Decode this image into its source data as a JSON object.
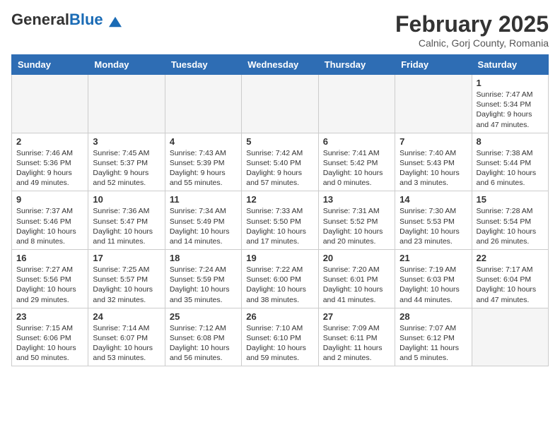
{
  "logo": {
    "general": "General",
    "blue": "Blue"
  },
  "header": {
    "month": "February 2025",
    "location": "Calnic, Gorj County, Romania"
  },
  "weekdays": [
    "Sunday",
    "Monday",
    "Tuesday",
    "Wednesday",
    "Thursday",
    "Friday",
    "Saturday"
  ],
  "weeks": [
    [
      {
        "day": "",
        "detail": ""
      },
      {
        "day": "",
        "detail": ""
      },
      {
        "day": "",
        "detail": ""
      },
      {
        "day": "",
        "detail": ""
      },
      {
        "day": "",
        "detail": ""
      },
      {
        "day": "",
        "detail": ""
      },
      {
        "day": "1",
        "detail": "Sunrise: 7:47 AM\nSunset: 5:34 PM\nDaylight: 9 hours and 47 minutes."
      }
    ],
    [
      {
        "day": "2",
        "detail": "Sunrise: 7:46 AM\nSunset: 5:36 PM\nDaylight: 9 hours and 49 minutes."
      },
      {
        "day": "3",
        "detail": "Sunrise: 7:45 AM\nSunset: 5:37 PM\nDaylight: 9 hours and 52 minutes."
      },
      {
        "day": "4",
        "detail": "Sunrise: 7:43 AM\nSunset: 5:39 PM\nDaylight: 9 hours and 55 minutes."
      },
      {
        "day": "5",
        "detail": "Sunrise: 7:42 AM\nSunset: 5:40 PM\nDaylight: 9 hours and 57 minutes."
      },
      {
        "day": "6",
        "detail": "Sunrise: 7:41 AM\nSunset: 5:42 PM\nDaylight: 10 hours and 0 minutes."
      },
      {
        "day": "7",
        "detail": "Sunrise: 7:40 AM\nSunset: 5:43 PM\nDaylight: 10 hours and 3 minutes."
      },
      {
        "day": "8",
        "detail": "Sunrise: 7:38 AM\nSunset: 5:44 PM\nDaylight: 10 hours and 6 minutes."
      }
    ],
    [
      {
        "day": "9",
        "detail": "Sunrise: 7:37 AM\nSunset: 5:46 PM\nDaylight: 10 hours and 8 minutes."
      },
      {
        "day": "10",
        "detail": "Sunrise: 7:36 AM\nSunset: 5:47 PM\nDaylight: 10 hours and 11 minutes."
      },
      {
        "day": "11",
        "detail": "Sunrise: 7:34 AM\nSunset: 5:49 PM\nDaylight: 10 hours and 14 minutes."
      },
      {
        "day": "12",
        "detail": "Sunrise: 7:33 AM\nSunset: 5:50 PM\nDaylight: 10 hours and 17 minutes."
      },
      {
        "day": "13",
        "detail": "Sunrise: 7:31 AM\nSunset: 5:52 PM\nDaylight: 10 hours and 20 minutes."
      },
      {
        "day": "14",
        "detail": "Sunrise: 7:30 AM\nSunset: 5:53 PM\nDaylight: 10 hours and 23 minutes."
      },
      {
        "day": "15",
        "detail": "Sunrise: 7:28 AM\nSunset: 5:54 PM\nDaylight: 10 hours and 26 minutes."
      }
    ],
    [
      {
        "day": "16",
        "detail": "Sunrise: 7:27 AM\nSunset: 5:56 PM\nDaylight: 10 hours and 29 minutes."
      },
      {
        "day": "17",
        "detail": "Sunrise: 7:25 AM\nSunset: 5:57 PM\nDaylight: 10 hours and 32 minutes."
      },
      {
        "day": "18",
        "detail": "Sunrise: 7:24 AM\nSunset: 5:59 PM\nDaylight: 10 hours and 35 minutes."
      },
      {
        "day": "19",
        "detail": "Sunrise: 7:22 AM\nSunset: 6:00 PM\nDaylight: 10 hours and 38 minutes."
      },
      {
        "day": "20",
        "detail": "Sunrise: 7:20 AM\nSunset: 6:01 PM\nDaylight: 10 hours and 41 minutes."
      },
      {
        "day": "21",
        "detail": "Sunrise: 7:19 AM\nSunset: 6:03 PM\nDaylight: 10 hours and 44 minutes."
      },
      {
        "day": "22",
        "detail": "Sunrise: 7:17 AM\nSunset: 6:04 PM\nDaylight: 10 hours and 47 minutes."
      }
    ],
    [
      {
        "day": "23",
        "detail": "Sunrise: 7:15 AM\nSunset: 6:06 PM\nDaylight: 10 hours and 50 minutes."
      },
      {
        "day": "24",
        "detail": "Sunrise: 7:14 AM\nSunset: 6:07 PM\nDaylight: 10 hours and 53 minutes."
      },
      {
        "day": "25",
        "detail": "Sunrise: 7:12 AM\nSunset: 6:08 PM\nDaylight: 10 hours and 56 minutes."
      },
      {
        "day": "26",
        "detail": "Sunrise: 7:10 AM\nSunset: 6:10 PM\nDaylight: 10 hours and 59 minutes."
      },
      {
        "day": "27",
        "detail": "Sunrise: 7:09 AM\nSunset: 6:11 PM\nDaylight: 11 hours and 2 minutes."
      },
      {
        "day": "28",
        "detail": "Sunrise: 7:07 AM\nSunset: 6:12 PM\nDaylight: 11 hours and 5 minutes."
      },
      {
        "day": "",
        "detail": ""
      }
    ]
  ]
}
